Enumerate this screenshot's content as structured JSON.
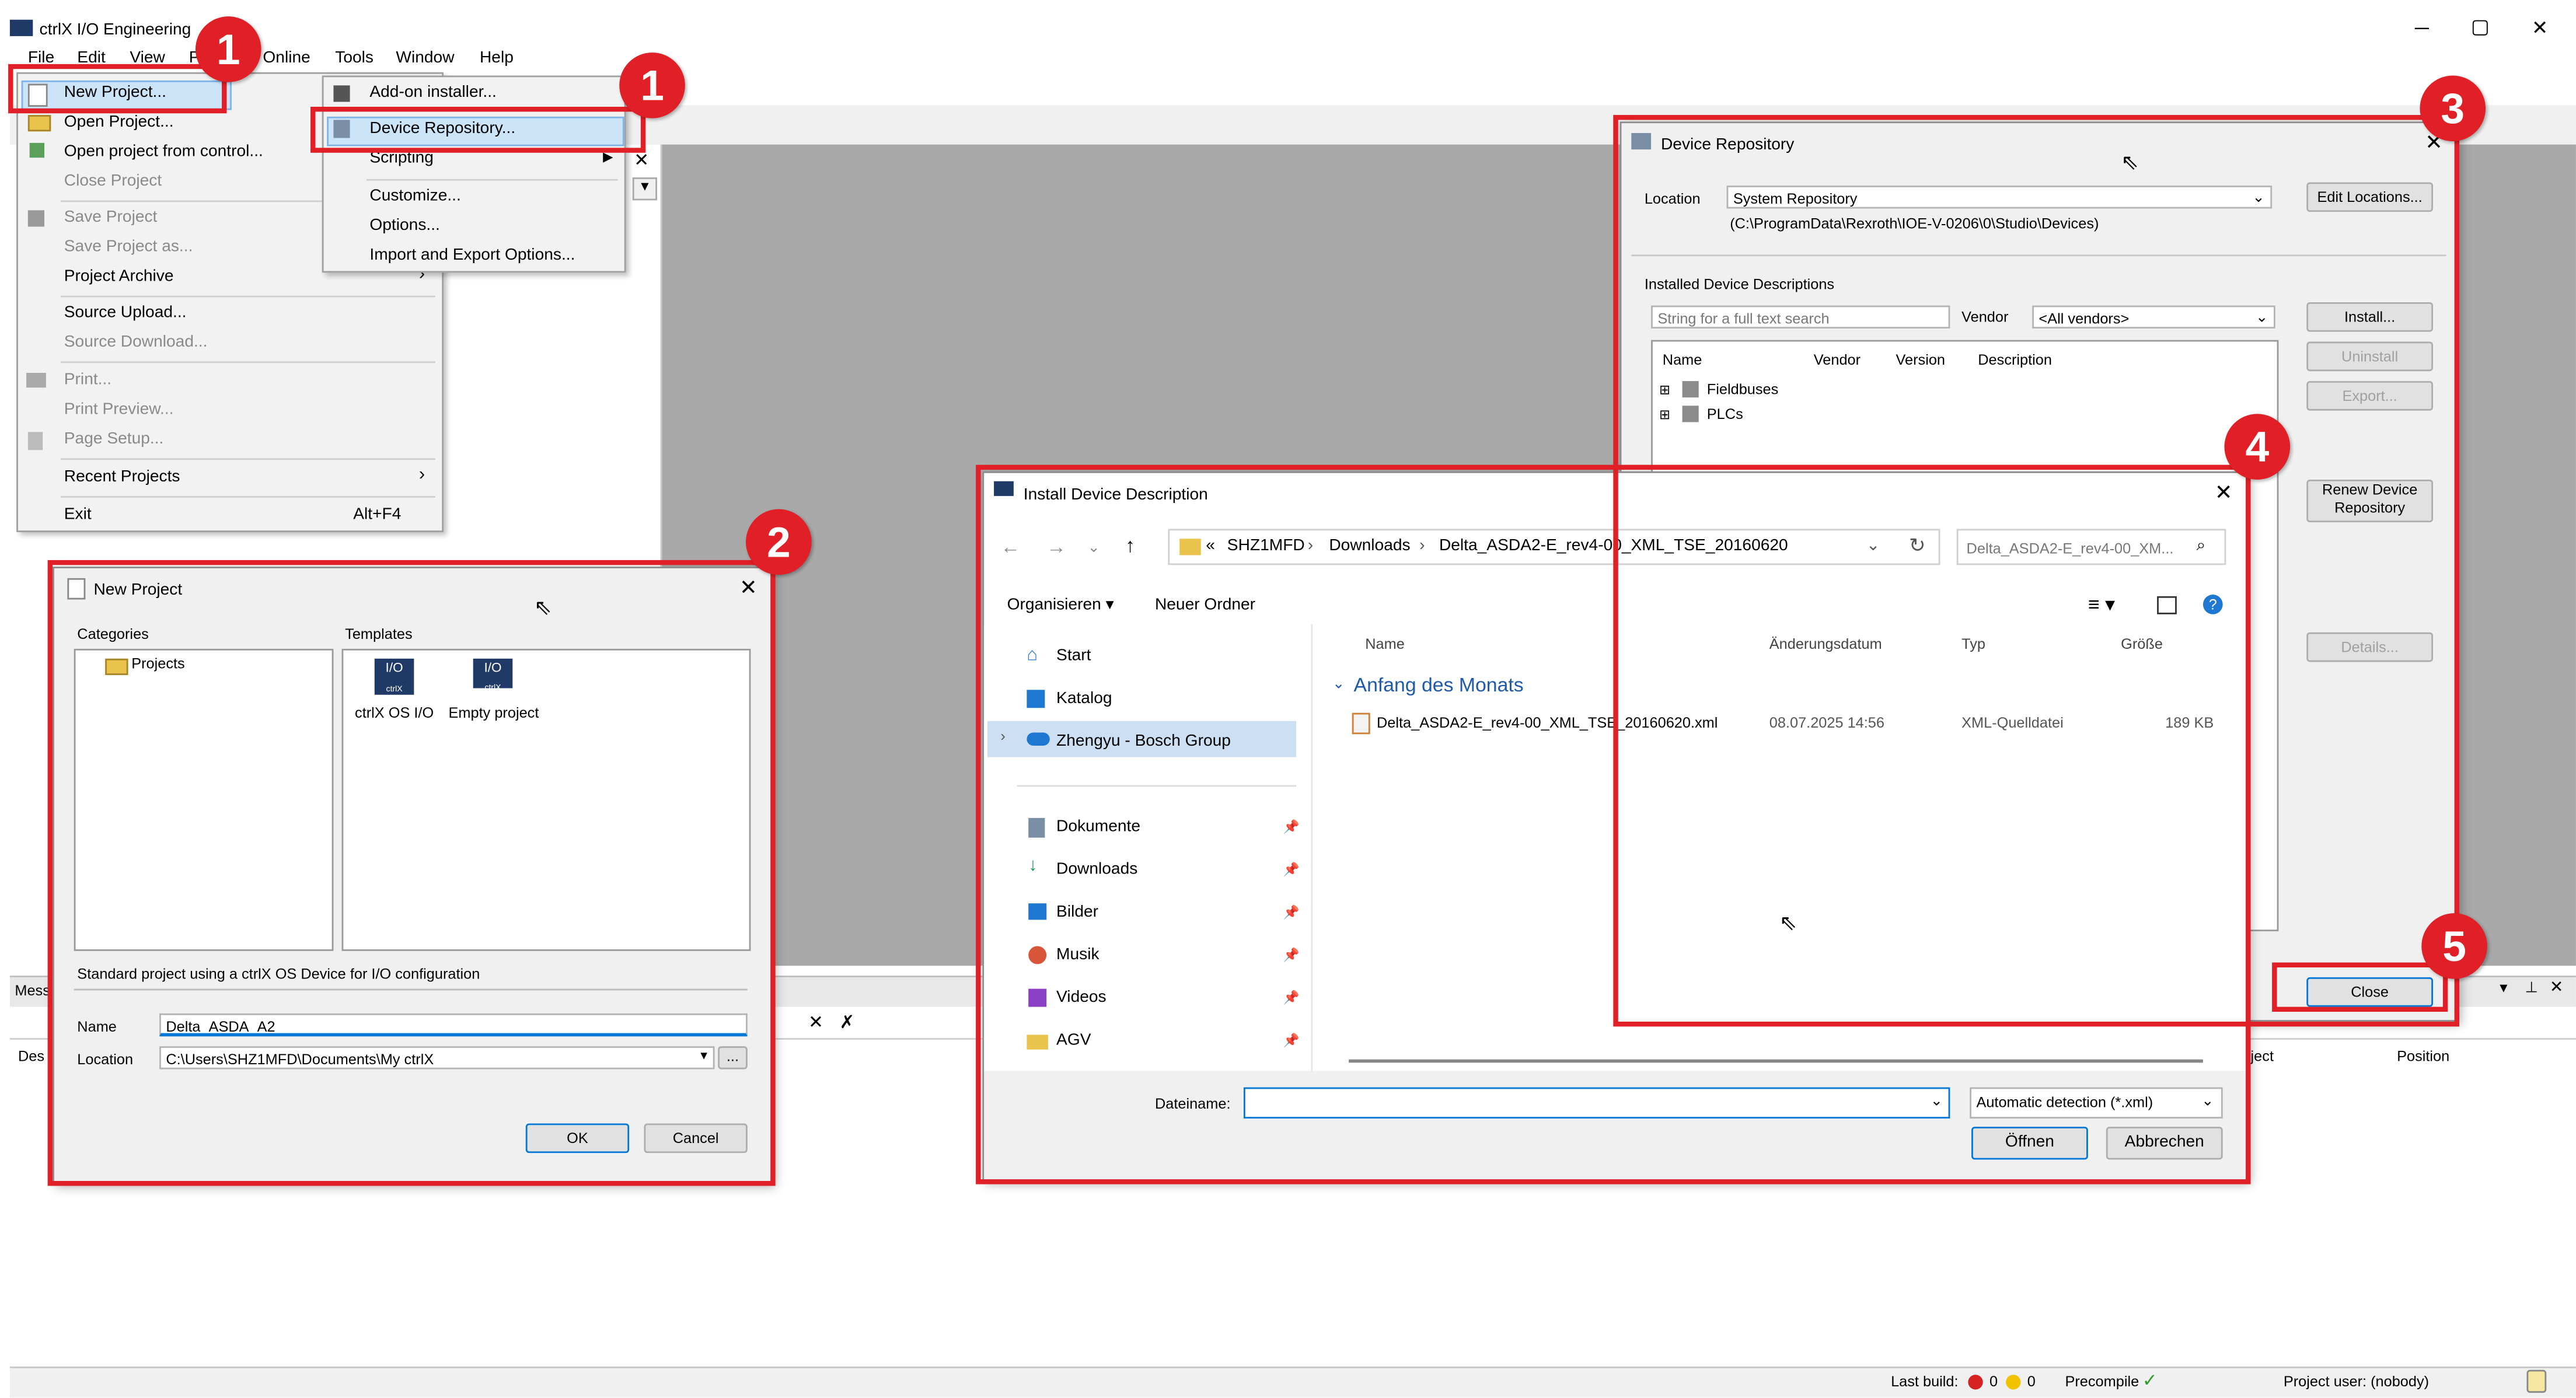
{
  "app": {
    "title": "ctrlX I/O Engineering",
    "menus": [
      "File",
      "Edit",
      "View",
      "P",
      "Online",
      "Tools",
      "Window",
      "Help"
    ],
    "minimize": "─",
    "maximize": "▢",
    "close": "✕"
  },
  "file_menu": {
    "items": [
      {
        "label": "New Project...",
        "disabled": false
      },
      {
        "label": "Open Project...",
        "disabled": false
      },
      {
        "label": "Open project from control...",
        "disabled": false
      },
      {
        "label": "Close Project",
        "disabled": true
      },
      {
        "label": "Save Project",
        "disabled": true
      },
      {
        "label": "Save Project as...",
        "disabled": true
      },
      {
        "label": "Project Archive",
        "disabled": false
      },
      {
        "label": "Source Upload...",
        "disabled": false
      },
      {
        "label": "Source Download...",
        "disabled": true
      },
      {
        "label": "Print...",
        "disabled": true
      },
      {
        "label": "Print Preview...",
        "disabled": true
      },
      {
        "label": "Page Setup...",
        "disabled": true
      },
      {
        "label": "Recent Projects",
        "disabled": false
      },
      {
        "label": "Exit",
        "disabled": false
      }
    ],
    "exit_shortcut": "Alt+F4",
    "submenu_arrow": "›"
  },
  "tools_menu": {
    "items": [
      "Add-on installer...",
      "Device Repository...",
      "Scripting",
      "Customize...",
      "Options...",
      "Import and Export Options..."
    ]
  },
  "new_project": {
    "title": "New Project",
    "categories_label": "Categories",
    "templates_label": "Templates",
    "category": "Projects",
    "templates": [
      "ctrlX OS I/O",
      "Empty project"
    ],
    "template_icon_text": "I/O",
    "template_icon_sub": "ctrlX",
    "description": "Standard project using a ctrlX OS Device for I/O configuration",
    "name_label": "Name",
    "name_value": "Delta_ASDA_A2",
    "location_label": "Location",
    "location_value": "C:\\Users\\SHZ1MFD\\Documents\\My ctrlX",
    "browse": "...",
    "ok": "OK",
    "cancel": "Cancel"
  },
  "device_repo": {
    "title": "Device Repository",
    "location_label": "Location",
    "location_value": "System Repository",
    "location_path": "(C:\\ProgramData\\Rexroth\\IOE-V-0206\\0\\Studio\\Devices)",
    "edit_locations": "Edit Locations...",
    "installed_label": "Installed Device Descriptions",
    "search_placeholder": "String for a full text search",
    "vendor_label": "Vendor",
    "vendor_value": "<All vendors>",
    "columns": [
      "Name",
      "Vendor",
      "Version",
      "Description"
    ],
    "tree": [
      "Fieldbuses",
      "PLCs"
    ],
    "install": "Install...",
    "uninstall": "Uninstall",
    "export": "Export...",
    "renew": "Renew Device Repository",
    "details": "Details...",
    "close": "Close"
  },
  "install_dialog": {
    "title": "Install Device Description",
    "breadcrumb": [
      "«",
      "SHZ1MFD",
      "Downloads",
      "Delta_ASDA2-E_rev4-00_XML_TSE_20160620"
    ],
    "search_placeholder": "Delta_ASDA2-E_rev4-00_XM...",
    "organize": "Organisieren",
    "new_folder": "Neuer Ordner",
    "nav": [
      "Start",
      "Katalog",
      "Zhengyu - Bosch Group",
      "Dokumente",
      "Downloads",
      "Bilder",
      "Musik",
      "Videos",
      "AGV"
    ],
    "columns": [
      "Name",
      "Änderungsdatum",
      "Typ",
      "Größe"
    ],
    "group": "Anfang des Monats",
    "file": {
      "name": "Delta_ASDA2-E_rev4-00_XML_TSE_20160620.xml",
      "date": "08.07.2025 14:56",
      "type": "XML-Quelldatei",
      "size": "189 KB"
    },
    "filename_label": "Dateiname:",
    "filter": "Automatic detection (*.xml)",
    "open": "Öffnen",
    "cancel": "Abbrechen"
  },
  "messages": {
    "tab": "Mess",
    "col_desc": "Des",
    "col_project": "roject",
    "col_position": "Position"
  },
  "status_bar": {
    "last_build": "Last build:",
    "errors": "0",
    "warnings": "0",
    "precompile": "Precompile",
    "project_user": "Project user: (nobody)"
  },
  "annotations": {
    "badge1": "1",
    "badge2": "2",
    "badge3": "3",
    "badge4": "4",
    "badge5": "5",
    "badge_color": "#e01f26"
  }
}
